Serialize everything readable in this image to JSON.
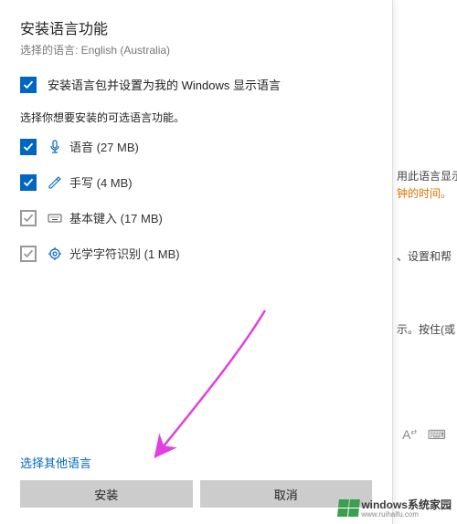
{
  "dialog": {
    "title": "安装语言功能",
    "subtitle": "选择的语言: English (Australia)",
    "set_display_label": "安装语言包并设置为我的 Windows 显示语言",
    "desc": "选择你想要安装的可选语言功能。",
    "options": {
      "speech": "语音 (27 MB)",
      "handwriting": "手写 (4 MB)",
      "typing": "基本键入 (17 MB)",
      "ocr": "光学字符识别 (1 MB)"
    },
    "link": "选择其他语言",
    "install_btn": "安装",
    "cancel_btn": "取消"
  },
  "bg": {
    "line1": "用此语言显示",
    "line2": "钟的时间。",
    "line3": "、设置和帮",
    "line4": "示。按住(或"
  },
  "watermark": {
    "brand": "windows",
    "suffix": "系统家园",
    "url": "www.ruihaifu.com"
  }
}
